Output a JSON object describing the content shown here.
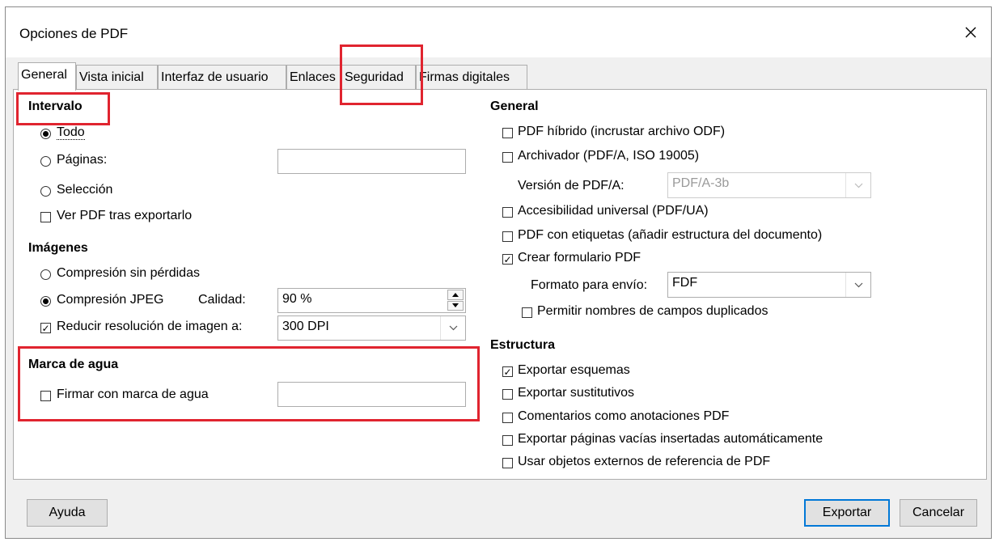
{
  "dialog": {
    "title": "Opciones de PDF"
  },
  "tabs": [
    {
      "label": "General",
      "active": true
    },
    {
      "label": "Vista inicial"
    },
    {
      "label": "Interfaz de usuario"
    },
    {
      "label": "Enlaces"
    },
    {
      "label": "Seguridad"
    },
    {
      "label": "Firmas digitales"
    }
  ],
  "left": {
    "range": {
      "heading": "Intervalo",
      "all": "Todo",
      "pages": "Páginas:",
      "pages_value": "",
      "selection": "Selección",
      "view_after": "Ver PDF tras exportarlo",
      "selected": "all",
      "view_after_checked": false
    },
    "images": {
      "heading": "Imágenes",
      "lossless": "Compresión sin pérdidas",
      "jpeg": "Compresión JPEG",
      "quality_label": "Calidad:",
      "quality_value": "90 %",
      "reduce": "Reducir resolución de imagen a:",
      "reduce_checked": true,
      "resolution_value": "300 DPI",
      "selected": "jpeg"
    },
    "watermark": {
      "heading": "Marca de agua",
      "sign": "Firmar con marca de agua",
      "sign_checked": false,
      "value": ""
    }
  },
  "right": {
    "general": {
      "heading": "General",
      "hybrid": "PDF híbrido (incrustar archivo ODF)",
      "hybrid_checked": false,
      "archive": "Archivador (PDF/A, ISO 19005)",
      "archive_checked": false,
      "pdfa_version_label": "Versión de PDF/A:",
      "pdfa_version_value": "PDF/A-3b",
      "accessibility": "Accesibilidad universal (PDF/UA)",
      "accessibility_checked": false,
      "tagged": "PDF con etiquetas (añadir estructura del documento)",
      "tagged_checked": false,
      "form": "Crear formulario PDF",
      "form_checked": true,
      "format_label": "Formato para envío:",
      "format_value": "FDF",
      "duplicates": "Permitir nombres de campos duplicados",
      "duplicates_checked": false
    },
    "structure": {
      "heading": "Estructura",
      "outlines": "Exportar esquemas",
      "outlines_checked": true,
      "placeholders": "Exportar sustitutivos",
      "placeholders_checked": false,
      "comments": "Comentarios como anotaciones PDF",
      "comments_checked": false,
      "blank_pages": "Exportar páginas vacías insertadas automáticamente",
      "blank_pages_checked": false,
      "xobjects": "Usar objetos externos de referencia de PDF",
      "xobjects_checked": false
    }
  },
  "buttons": {
    "help": "Ayuda",
    "export": "Exportar",
    "cancel": "Cancelar"
  },
  "colors": {
    "highlight": "#e0242f",
    "default_button": "#0078d7"
  },
  "icons": {
    "close": "close-icon",
    "dropdown": "chevron-down-icon",
    "spin_up": "spin-up-icon",
    "spin_down": "spin-down-icon"
  }
}
